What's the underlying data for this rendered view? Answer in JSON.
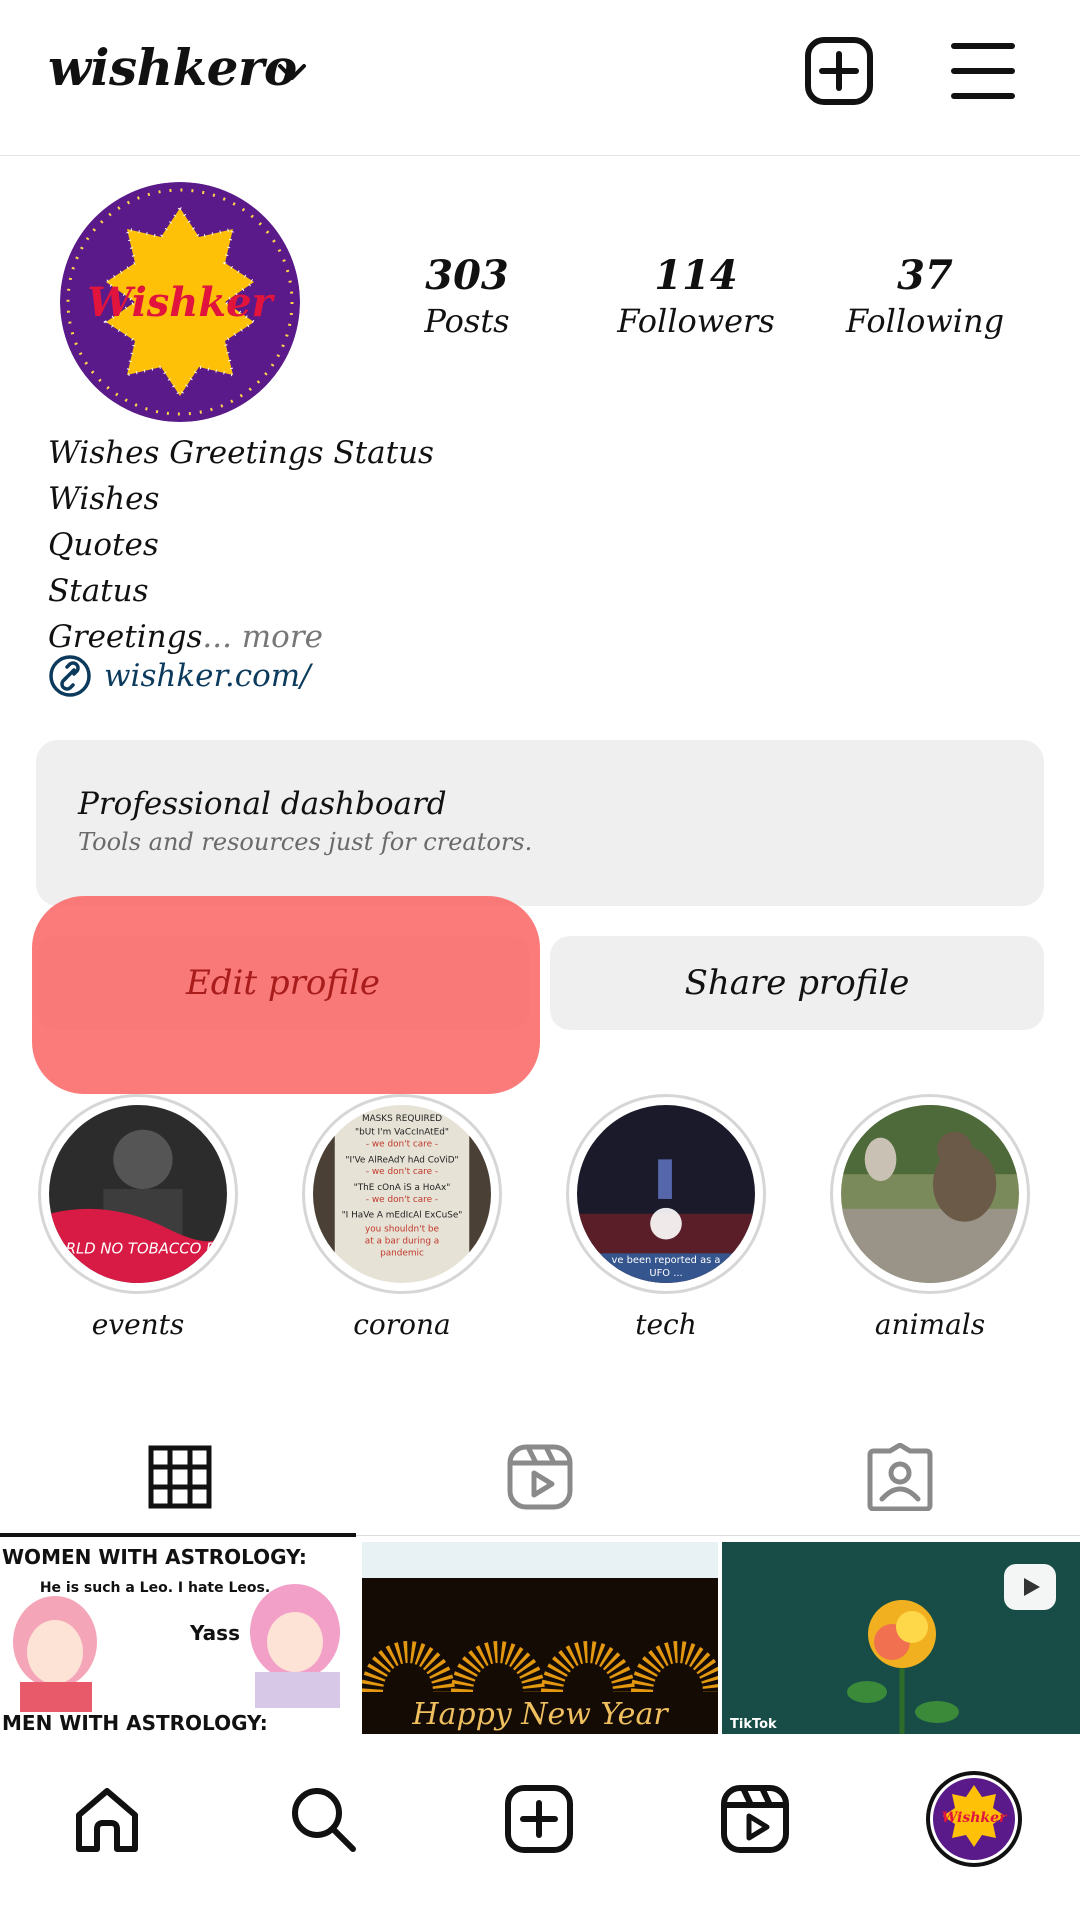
{
  "header": {
    "username": "wishkero",
    "icons": [
      "chevron-down-icon",
      "add-post-icon",
      "menu-icon"
    ]
  },
  "profile": {
    "avatar_text": "Wishker",
    "stats": [
      {
        "value": "303",
        "label": "Posts"
      },
      {
        "value": "114",
        "label": "Followers"
      },
      {
        "value": "37",
        "label": "Following"
      }
    ],
    "bio_lines": [
      "Wishes Greetings Status",
      "Wishes",
      "Quotes",
      "Status"
    ],
    "bio_last_line": "Greetings",
    "bio_more": "... more",
    "link": "wishker.com/"
  },
  "dashboard": {
    "title": "Professional dashboard",
    "subtitle": "Tools and resources just for creators."
  },
  "buttons": {
    "edit": "Edit profile",
    "share": "Share profile"
  },
  "highlights": [
    {
      "label": "events",
      "caption": "WORLD NO TOBACCO DAY"
    },
    {
      "label": "corona",
      "caption_lines": [
        "MASKS REQUIRED",
        "\"bUt I'm VaCcInAtEd\"",
        "- we don't care -",
        "\"I'Ve AlReAdY hAd CoViD\"",
        "- we don't care -",
        "\"ThE cOnA iS a HoAx\"",
        "- we don't care -",
        "\"I HaVe A mEdIcAl ExCuSe\"",
        "you shouldn't be",
        "at a bar during a",
        "pandemic"
      ]
    },
    {
      "label": "tech",
      "caption_lines": [
        "ve been reported as a",
        "UFO ..."
      ]
    },
    {
      "label": "animals"
    }
  ],
  "tabs": [
    "grid-icon",
    "reels-icon",
    "tagged-icon"
  ],
  "posts": [
    {
      "top_text": "WOMEN WITH ASTROLOGY:",
      "speech": "He is such a Leo. I hate Leos.",
      "reply": "Yass",
      "bottom_text": "MEN WITH ASTROLOGY:"
    },
    {
      "caption": "Happy New Year"
    },
    {
      "badge": "TikTok"
    }
  ],
  "tiktok_label": "TikTok",
  "bottom_nav": [
    "home-icon",
    "search-icon",
    "create-icon",
    "reels-icon",
    "profile-avatar"
  ],
  "colors": {
    "avatar_purple": "#5a1a8a",
    "avatar_yellow": "#ffc107",
    "avatar_text": "#e0143c",
    "highlight": "#f86464",
    "link": "#0b3a5c"
  }
}
